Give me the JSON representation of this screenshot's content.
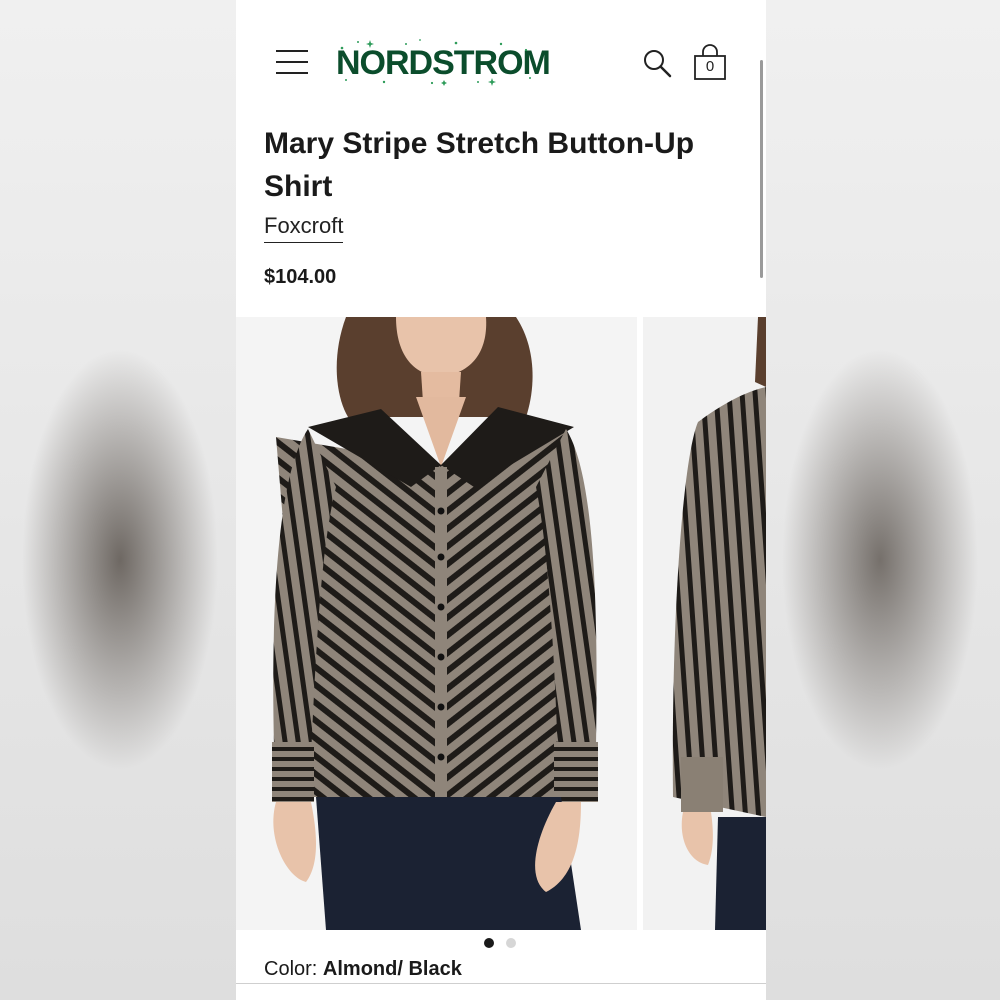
{
  "header": {
    "logo_text": "NORDSTROM",
    "bag_count": "0",
    "logo_color": "#0b4d2c",
    "icons": [
      "menu-icon",
      "search-icon",
      "shopping-bag-icon"
    ]
  },
  "product": {
    "title": "Mary Stripe Stretch Button-Up Shirt",
    "brand": "Foxcroft",
    "price": "$104.00",
    "color_label": "Color:",
    "color_value": "Almond/ Black"
  },
  "gallery": {
    "image_count": 2,
    "active_index": 0,
    "colors": {
      "stripe_light": "#8f857a",
      "stripe_dark": "#1e1b18",
      "pants": "#1b2233"
    }
  }
}
